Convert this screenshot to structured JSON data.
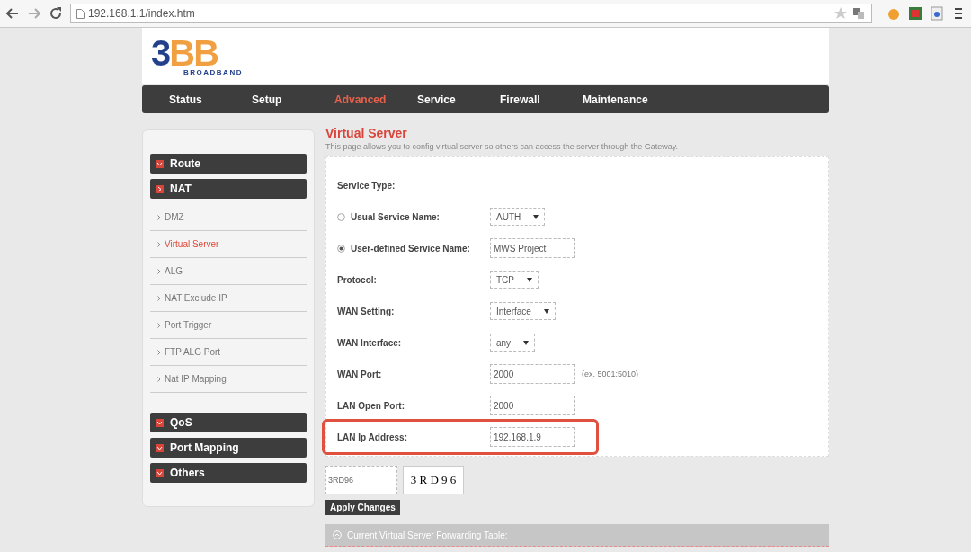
{
  "browser": {
    "url": "192.168.1.1/index.htm"
  },
  "logo": {
    "mark": "3BB",
    "tagline": "BROADBAND"
  },
  "nav": [
    {
      "label": "Status",
      "selected": false
    },
    {
      "label": "Setup",
      "selected": false
    },
    {
      "label": "Advanced",
      "selected": true
    },
    {
      "label": "Service",
      "selected": false
    },
    {
      "label": "Firewall",
      "selected": false
    },
    {
      "label": "Maintenance",
      "selected": false
    }
  ],
  "sidebar": [
    {
      "label": "Route",
      "expanded": false
    },
    {
      "label": "NAT",
      "expanded": true,
      "children": [
        {
          "label": "DMZ",
          "selected": false
        },
        {
          "label": "Virtual Server",
          "selected": true
        },
        {
          "label": "ALG",
          "selected": false
        },
        {
          "label": "NAT Exclude IP",
          "selected": false
        },
        {
          "label": "Port Trigger",
          "selected": false
        },
        {
          "label": "FTP ALG Port",
          "selected": false
        },
        {
          "label": "Nat IP Mapping",
          "selected": false
        }
      ]
    },
    {
      "label": "QoS",
      "expanded": false
    },
    {
      "label": "Port Mapping",
      "expanded": false
    },
    {
      "label": "Others",
      "expanded": false
    }
  ],
  "page": {
    "title": "Virtual Server",
    "description": "This page allows you to config virtual server so others can access the server through the Gateway."
  },
  "form": [
    {
      "kind": "heading",
      "label": "Service Type:",
      "highlighted": false
    },
    {
      "kind": "radio",
      "label": "Usual Service Name:",
      "selected": false,
      "highlighted": false,
      "control": {
        "kind": "select",
        "value": "AUTH"
      }
    },
    {
      "kind": "radio",
      "label": "User-defined Service Name:",
      "selected": true,
      "highlighted": false,
      "control": {
        "kind": "input",
        "value": "MWS Project"
      }
    },
    {
      "kind": "field",
      "label": "Protocol:",
      "highlighted": false,
      "control": {
        "kind": "select",
        "value": "TCP"
      }
    },
    {
      "kind": "field",
      "label": "WAN Setting:",
      "highlighted": false,
      "control": {
        "kind": "select",
        "value": "Interface"
      }
    },
    {
      "kind": "field",
      "label": "WAN Interface:",
      "highlighted": false,
      "control": {
        "kind": "select",
        "value": "any"
      }
    },
    {
      "kind": "field",
      "label": "WAN Port:",
      "highlighted": false,
      "control": {
        "kind": "input",
        "value": "2000"
      },
      "note": "(ex. 5001:5010)"
    },
    {
      "kind": "field",
      "label": "LAN Open Port:",
      "highlighted": false,
      "control": {
        "kind": "input",
        "value": "2000"
      }
    },
    {
      "kind": "field",
      "label": "LAN Ip Address:",
      "highlighted": true,
      "control": {
        "kind": "input",
        "value": "192.168.1.9"
      }
    }
  ],
  "captcha": {
    "value": "3RD96",
    "image_text": "3 R D 9 6"
  },
  "apply_button": "Apply Changes",
  "table_header": "Current Virtual Server Forwarding Table:"
}
